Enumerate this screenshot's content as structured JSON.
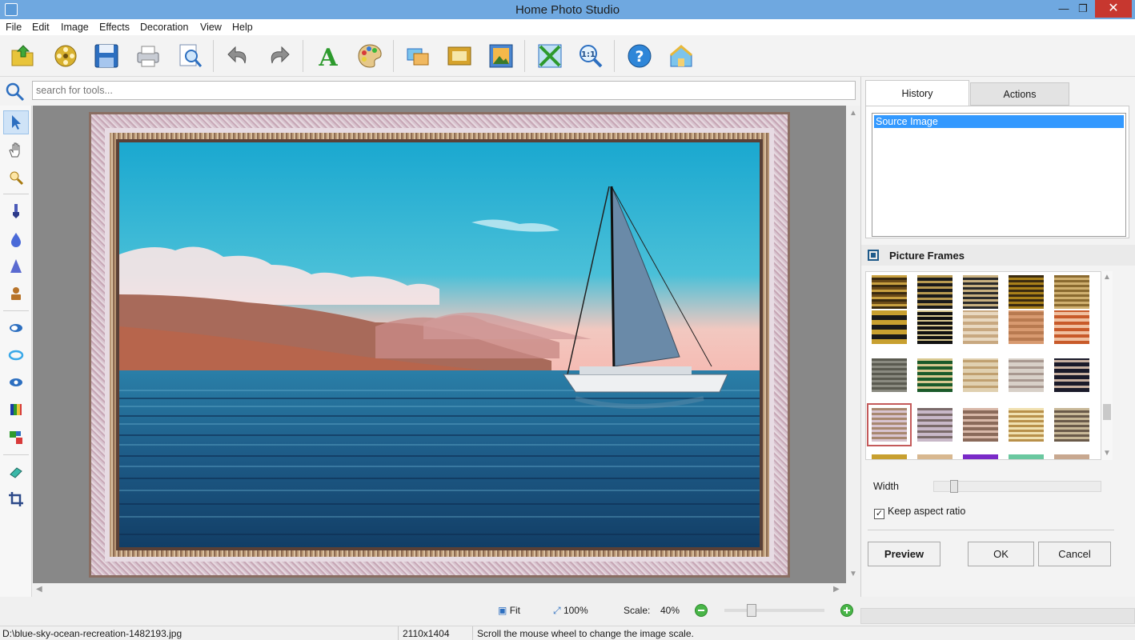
{
  "window": {
    "title": "Home Photo Studio"
  },
  "menu": [
    "File",
    "Edit",
    "Image",
    "Effects",
    "Decoration",
    "View",
    "Help"
  ],
  "search": {
    "placeholder": "search for tools..."
  },
  "right_panel": {
    "tabs": [
      "History",
      "Actions"
    ],
    "history_items": [
      "Source Image"
    ],
    "picture_frames_title": "Picture Frames",
    "width_label": "Width",
    "keep_aspect_label": "Keep aspect ratio",
    "keep_aspect_checked": true,
    "buttons": {
      "preview": "Preview",
      "ok": "OK",
      "cancel": "Cancel"
    }
  },
  "zoom": {
    "fit_label": "Fit",
    "hundred_label": "100%",
    "scale_label": "Scale:",
    "scale_value": "40%"
  },
  "status": {
    "file_path": "D:\\blue-sky-ocean-recreation-1482193.jpg",
    "dimensions": "2110x1404",
    "hint": "Scroll the mouse wheel to change the image scale."
  },
  "colors": {
    "title_bar": "#6fa8e0",
    "selection": "#3399ff",
    "close_button": "#c7372f"
  }
}
